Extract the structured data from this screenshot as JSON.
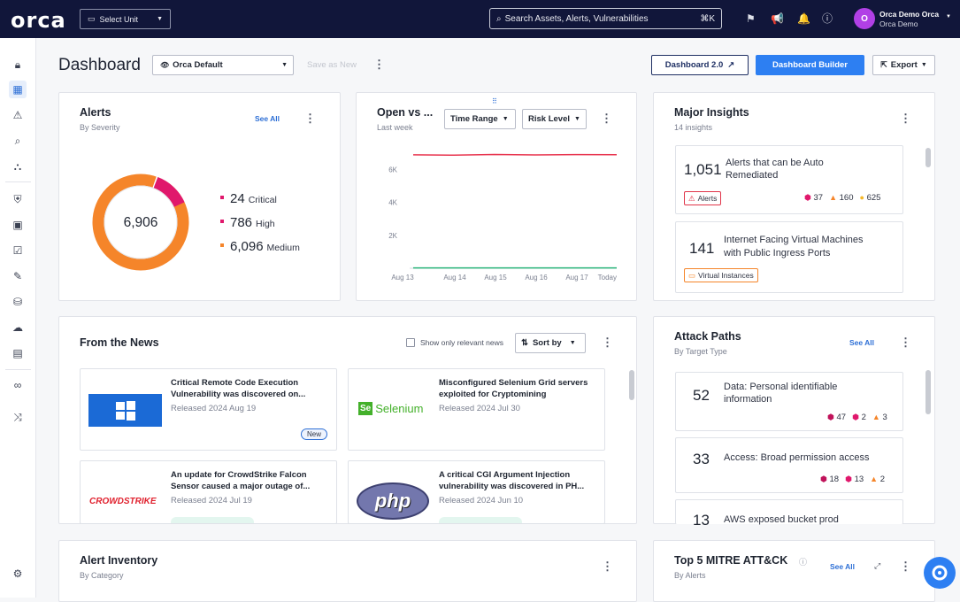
{
  "topbar": {
    "logo": "orca",
    "unit_select": "Select Unit",
    "search_placeholder": "Search Assets, Alerts, Vulnerabilities",
    "search_shortcut": "⌘K",
    "user_initial": "O",
    "user_name": "Orca Demo Orca",
    "user_org": "Orca Demo"
  },
  "header": {
    "title": "Dashboard",
    "dashboard_select": "Orca Default",
    "save_as_new": "Save as New",
    "dashboard2_label": "Dashboard 2.0",
    "builder_label": "Dashboard Builder",
    "export_label": "Export"
  },
  "alerts_card": {
    "title": "Alerts",
    "subtitle": "By Severity",
    "see_all": "See All",
    "total": "6,906",
    "legend": [
      {
        "value": "24",
        "label": "Critical",
        "color": "#e0186c"
      },
      {
        "value": "786",
        "label": "High",
        "color": "#e0186c"
      },
      {
        "value": "6,096",
        "label": "Medium",
        "color": "#f5852a"
      }
    ]
  },
  "open_card": {
    "title": "Open vs ...",
    "subtitle": "Last week",
    "time_range": "Time Range",
    "risk_level": "Risk Level"
  },
  "chart_data": {
    "type": "line",
    "x": [
      "Aug 13",
      "Aug 14",
      "Aug 15",
      "Aug 16",
      "Aug 17",
      "Today"
    ],
    "y_ticks": [
      "6K",
      "4K",
      "2K"
    ],
    "ylim": [
      0,
      7000
    ],
    "series": [
      {
        "values": [
          6900,
          6880,
          6920,
          6890,
          6910,
          6906
        ],
        "color": "#e8354f"
      },
      {
        "values": [
          20,
          20,
          20,
          20,
          20,
          20
        ],
        "color": "#2bb57a"
      }
    ]
  },
  "insights_card": {
    "title": "Major Insights",
    "subtitle": "14 insights",
    "items": [
      {
        "value": "1,051",
        "text_line1": "Alerts that can be Auto",
        "text_line2": "Remediated",
        "tag": "Alerts",
        "sev_crit": "37",
        "sev_high": "160",
        "sev_med": "625"
      },
      {
        "value": "141",
        "text_line1": "Internet Facing Virtual Machines",
        "text_line2": "with Public Ingress Ports",
        "tag": "Virtual Instances"
      }
    ]
  },
  "news_card": {
    "title": "From the News",
    "show_relevant": "Show only relevant news",
    "sort_by": "Sort by",
    "items": [
      {
        "title_line1": "Critical Remote Code Execution",
        "title_line2": "Vulnerability was discovered on...",
        "date": "Released 2024 Aug 19",
        "badge": "New"
      },
      {
        "title_line1": "Misconfigured Selenium Grid servers",
        "title_line2": "exploited for Cryptomining",
        "date": "Released 2024 Jul 30",
        "logo_text": "Selenium",
        "logo_se": "Se"
      },
      {
        "title_line1": "An update for CrowdStrike Falcon",
        "title_line2": "Sensor caused a major outage of...",
        "date": "Released 2024 Jul 19",
        "logo_text": "CROWDSTRIKE"
      },
      {
        "title_line1": "A critical CGI Argument Injection",
        "title_line2": "vulnerability was discovered in PH...",
        "date": "Released 2024 Jun 10",
        "logo_text": "php"
      }
    ]
  },
  "attack_card": {
    "title": "Attack Paths",
    "subtitle": "By Target Type",
    "see_all": "See All",
    "items": [
      {
        "value": "52",
        "text_line1": "Data: Personal identifiable",
        "text_line2": "information",
        "crit": "47",
        "high": "2",
        "med": "3"
      },
      {
        "value": "33",
        "text_line1": "Access: Broad permission access",
        "crit": "18",
        "high": "13",
        "med": "2"
      },
      {
        "value": "13",
        "text_line1": "AWS exposed bucket prod"
      }
    ]
  },
  "inventory_card": {
    "title": "Alert Inventory",
    "subtitle": "By Category"
  },
  "mitre_card": {
    "title": "Top 5 MITRE ATT&CK",
    "subtitle": "By Alerts",
    "see_all": "See All"
  }
}
